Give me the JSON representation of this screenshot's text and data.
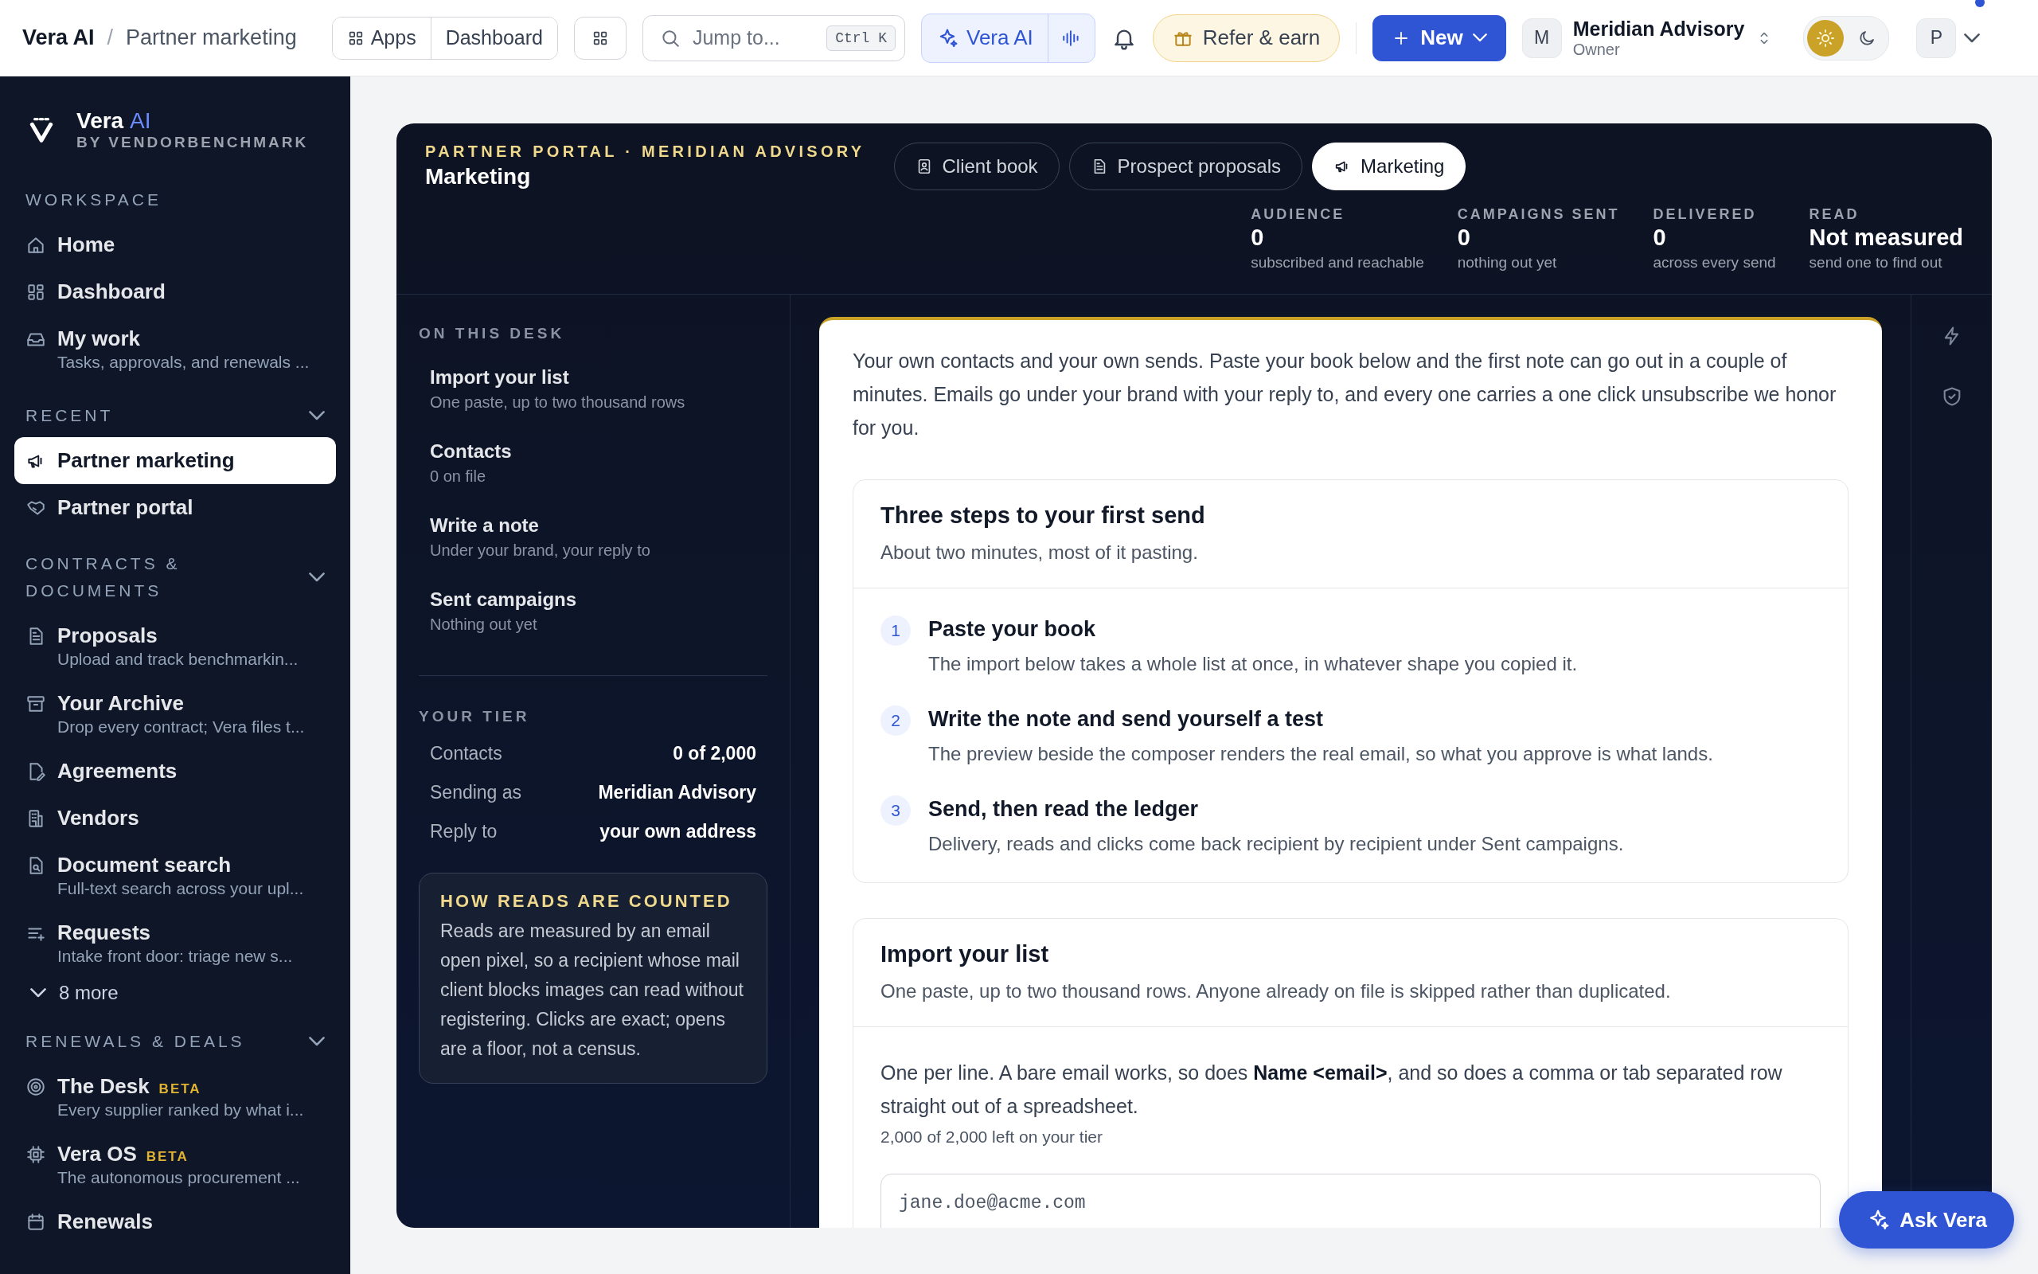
{
  "topbar": {
    "brand": "Vera AI",
    "separator": "/",
    "page": "Partner marketing",
    "nav": [
      {
        "label": "Apps"
      },
      {
        "label": "Dashboard"
      }
    ],
    "search": {
      "placeholder": "Jump to...",
      "shortcut": "Ctrl K"
    },
    "ai_button": "Vera AI",
    "refer_button": "Refer & earn",
    "new_button": "New",
    "account": {
      "avatar": "M",
      "name": "Meridian Advisory",
      "role": "Owner"
    },
    "theme": [
      {
        "kind": "light",
        "selected": true
      },
      {
        "kind": "dark",
        "selected": false
      }
    ],
    "user_avatar": "P"
  },
  "sidebar": {
    "logo": {
      "name": "Vera",
      "accent": "AI",
      "tagline": "BY VENDORBENCHMARK"
    },
    "sections": [
      {
        "title": "WORKSPACE",
        "collapsible": false,
        "items": [
          {
            "label": "Home",
            "selected": false
          },
          {
            "label": "Dashboard",
            "selected": false
          },
          {
            "label": "My work",
            "subtitle": "Tasks, approvals, and renewals ...",
            "selected": false
          }
        ]
      },
      {
        "title": "RECENT",
        "collapsible": true,
        "items": [
          {
            "label": "Partner marketing",
            "selected": true
          },
          {
            "label": "Partner portal",
            "selected": false
          }
        ]
      },
      {
        "title": "CONTRACTS & DOCUMENTS",
        "collapsible": true,
        "items": [
          {
            "label": "Proposals",
            "subtitle": "Upload and track benchmarkin...",
            "selected": false
          },
          {
            "label": "Your Archive",
            "subtitle": "Drop every contract; Vera files t...",
            "selected": false
          },
          {
            "label": "Agreements",
            "selected": false
          },
          {
            "label": "Vendors",
            "selected": false
          },
          {
            "label": "Document search",
            "subtitle": "Full-text search across your upl...",
            "selected": false
          },
          {
            "label": "Requests",
            "subtitle": "Intake front door: triage new s...",
            "selected": false
          }
        ],
        "more": "8 more"
      },
      {
        "title": "RENEWALS & DEALS",
        "collapsible": true,
        "items": [
          {
            "label": "The Desk",
            "badge": "BETA",
            "subtitle": "Every supplier ranked by what i...",
            "selected": false
          },
          {
            "label": "Vera OS",
            "badge": "BETA",
            "subtitle": "The autonomous procurement ...",
            "selected": false
          },
          {
            "label": "Renewals",
            "selected": false
          }
        ]
      }
    ]
  },
  "portal": {
    "eyebrow": "PARTNER PORTAL · MERIDIAN ADVISORY",
    "title": "Marketing",
    "tabs": [
      {
        "label": "Client book",
        "selected": false
      },
      {
        "label": "Prospect proposals",
        "selected": false
      },
      {
        "label": "Marketing",
        "selected": true
      }
    ],
    "stats": [
      {
        "label": "AUDIENCE",
        "value": "0",
        "note": "subscribed and reachable"
      },
      {
        "label": "CAMPAIGNS SENT",
        "value": "0",
        "note": "nothing out yet"
      },
      {
        "label": "DELIVERED",
        "value": "0",
        "note": "across every send"
      },
      {
        "label": "READ",
        "value": "Not measured",
        "note": "send one to find out"
      }
    ],
    "desk": {
      "title": "ON THIS DESK",
      "items": [
        {
          "title": "Import your list",
          "subtitle": "One paste, up to two thousand rows"
        },
        {
          "title": "Contacts",
          "subtitle": "0 on file"
        },
        {
          "title": "Write a note",
          "subtitle": "Under your brand, your reply to"
        },
        {
          "title": "Sent campaigns",
          "subtitle": "Nothing out yet"
        }
      ]
    },
    "tier": {
      "title": "YOUR TIER",
      "rows": [
        {
          "label": "Contacts",
          "value": "0 of 2,000"
        },
        {
          "label": "Sending as",
          "value": "Meridian Advisory"
        },
        {
          "label": "Reply to",
          "value": "your own address"
        }
      ]
    },
    "callout": {
      "title": "HOW READS ARE COUNTED",
      "text": "Reads are measured by an email open pixel, so a recipient whose mail client blocks images can read without registering. Clicks are exact; opens are a floor, not a census."
    },
    "intro": "Your own contacts and your own sends. Paste your book below and the first note can go out in a couple of minutes. Emails go under your brand with your reply to, and every one carries a one click unsubscribe we honor for you.",
    "steps_card": {
      "title": "Three steps to your first send",
      "subtitle": "About two minutes, most of it pasting.",
      "steps": [
        {
          "number": "1",
          "title": "Paste your book",
          "text": "The import below takes a whole list at once, in whatever shape you copied it."
        },
        {
          "number": "2",
          "title": "Write the note and send yourself a test",
          "text": "The preview beside the composer renders the real email, so what you approve is what lands."
        },
        {
          "number": "3",
          "title": "Send, then read the ledger",
          "text": "Delivery, reads and clicks come back recipient by recipient under Sent campaigns."
        }
      ]
    },
    "import_card": {
      "title": "Import your list",
      "subtitle": "One paste, up to two thousand rows. Anyone already on file is skipped rather than duplicated.",
      "help": "One per line. A bare email works, so does **Name <email>**, and so does a comma or tab separated row straight out of a spreadsheet.",
      "remaining": "2,000 of 2,000 left on your tier",
      "input": {
        "placeholder": "jane.doe@acme.com"
      }
    }
  },
  "ask_button": "Ask Vera"
}
